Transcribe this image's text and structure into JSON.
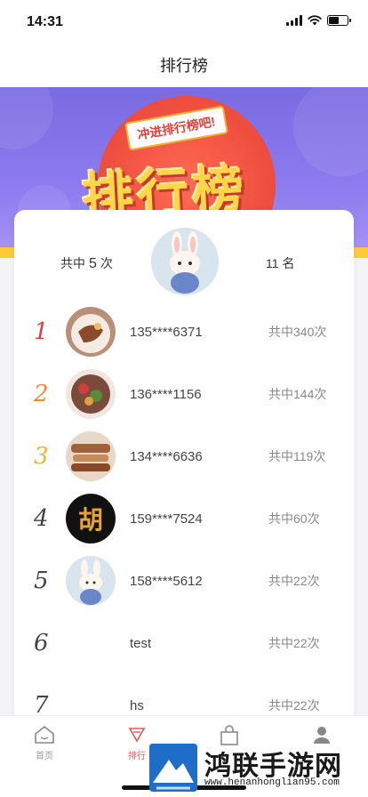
{
  "status_bar": {
    "time": "14:31"
  },
  "nav": {
    "title": "排行榜"
  },
  "banner": {
    "ribbon": "冲进排行榜吧!",
    "headline": "排行榜"
  },
  "my_stats": {
    "count_prefix": "共中",
    "count_value": "5",
    "count_suffix": "次",
    "rank_value": "11",
    "rank_suffix": "名"
  },
  "ranking": [
    {
      "rank": "1",
      "phone": "135****6371",
      "hits": "共中340次",
      "avatar": "food-plate-avatar"
    },
    {
      "rank": "2",
      "phone": "136****1156",
      "hits": "共中144次",
      "avatar": "salad-avatar"
    },
    {
      "rank": "3",
      "phone": "134****6636",
      "hits": "共中119次",
      "avatar": "bread-avatar"
    },
    {
      "rank": "4",
      "phone": "159****7524",
      "hits": "共中60次",
      "avatar": "calligraphy-avatar",
      "avatar_text": "胡"
    },
    {
      "rank": "5",
      "phone": "158****5612",
      "hits": "共中22次",
      "avatar": "bunny-avatar"
    },
    {
      "rank": "6",
      "phone": "test",
      "hits": "共中22次",
      "avatar": ""
    },
    {
      "rank": "7",
      "phone": "hs",
      "hits": "共中22次",
      "avatar": ""
    }
  ],
  "colors": {
    "rank_1": "#e23b3b",
    "rank_2": "#f08a2e",
    "rank_3": "#f2b233",
    "rank_other": "#444444",
    "accent": "#e25a54"
  },
  "tab_bar": {
    "tabs": [
      {
        "label": "首页",
        "icon": "home-icon"
      },
      {
        "label": "排行",
        "icon": "ranking-icon"
      },
      {
        "label": "",
        "icon": "bag-icon"
      },
      {
        "label": "",
        "icon": "profile-icon"
      }
    ]
  },
  "watermark": {
    "title": "鸿联手游网",
    "url": "www.henanhonglian95.com"
  }
}
